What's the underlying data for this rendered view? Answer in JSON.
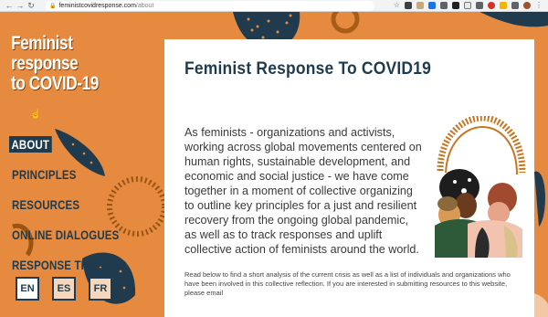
{
  "browser": {
    "url_domain": "feministcovidresponse.com",
    "url_path": "/about"
  },
  "site": {
    "logo_lines": [
      "Feminist",
      "response",
      "to COVID-19"
    ]
  },
  "menu": {
    "items": [
      {
        "label": "ABOUT",
        "active": true
      },
      {
        "label": "PRINCIPLES",
        "active": false
      },
      {
        "label": "RESOURCES",
        "active": false
      },
      {
        "label": "ONLINE DIALOGUES",
        "active": false
      },
      {
        "label": "RESPONSE TRACKER",
        "active": false
      }
    ]
  },
  "languages": [
    {
      "code": "EN",
      "active": true
    },
    {
      "code": "ES",
      "active": false
    },
    {
      "code": "FR",
      "active": false
    }
  ],
  "content": {
    "title": "Feminist Response To COVID19",
    "intro": "As feminists - organizations and activists, working across global movements centered on human rights, sustainable development, and economic and social justice - we have come together in a moment of collective organizing to outline key principles for a just and resilient recovery from the ongoing global pandemic, as well as to track responses and uplift collective action of feminists around the world.",
    "small_text": "Read below to find a short analysis of the current crisis as well as a list of individuals and organizations who have been involved in this collective reflection. If you are interested in submitting resources to this website, please email"
  },
  "colors": {
    "background": "#e58a3f",
    "navy": "#1f3b4d",
    "card": "#ffffff"
  }
}
